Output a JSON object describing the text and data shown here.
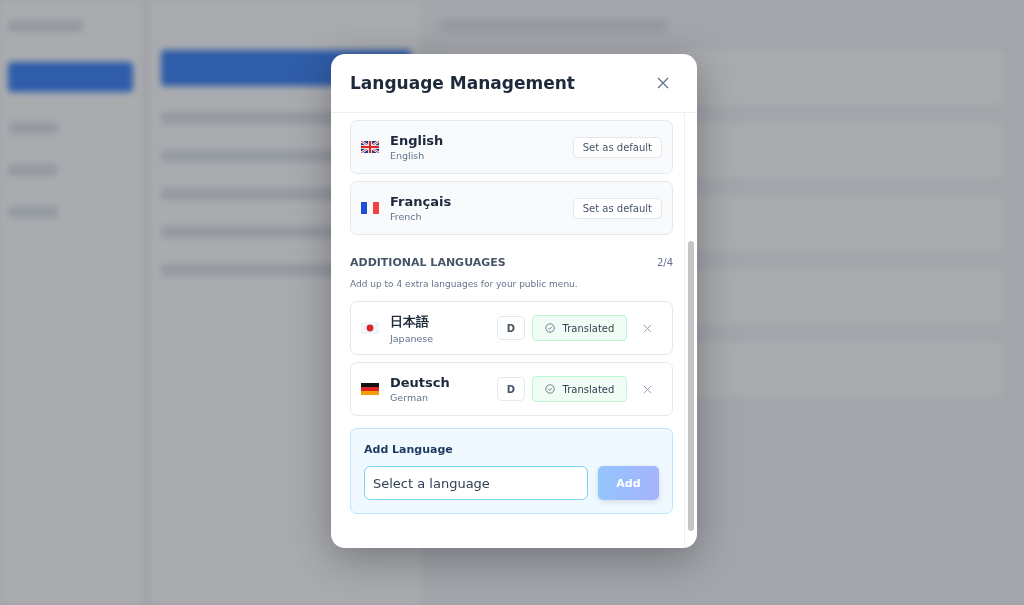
{
  "dialog": {
    "title": "Language Management",
    "default_languages": [
      {
        "kind": "uk",
        "name": "English",
        "subtitle": "English",
        "action": "Set as default"
      },
      {
        "kind": "fr",
        "name": "Français",
        "subtitle": "French",
        "action": "Set as default"
      }
    ],
    "additional": {
      "heading": "ADDITIONAL LANGUAGES",
      "count": "2/4",
      "description": "Add up to 4 extra languages for your public menu.",
      "languages": [
        {
          "kind": "jp",
          "name": "日本語",
          "subtitle": "Japanese",
          "code": "D",
          "status": "Translated",
          "translated": true
        },
        {
          "kind": "de",
          "name": "Deutsch",
          "subtitle": "German",
          "code": "D",
          "status": "Translated",
          "translated": true
        }
      ]
    },
    "add_language": {
      "label": "Add Language",
      "select_value": "Select a language",
      "button": "Add",
      "button_disabled": true
    }
  }
}
